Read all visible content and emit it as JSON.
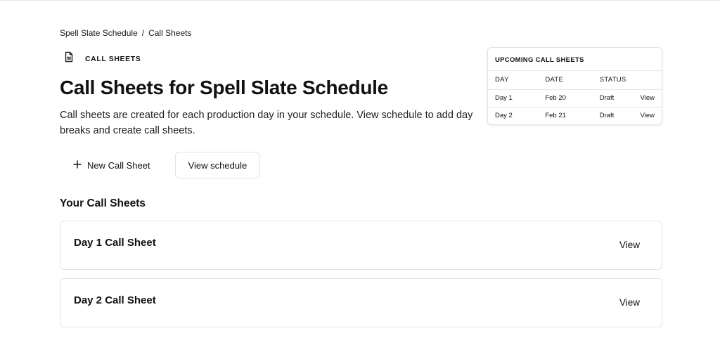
{
  "breadcrumb": {
    "parent": "Spell Slate Schedule",
    "separator": "/",
    "current": "Call Sheets"
  },
  "section": {
    "label": "CALL SHEETS",
    "icon": "document-icon"
  },
  "page": {
    "title": "Call Sheets for Spell Slate Schedule",
    "description": "Call sheets are created for each production day in your schedule. View schedule to add day breaks and create call sheets."
  },
  "actions": {
    "new_call_sheet": "New Call Sheet",
    "view_schedule": "View schedule"
  },
  "your_call_sheets": {
    "heading": "Your Call Sheets",
    "items": [
      {
        "name": "Day 1 Call Sheet",
        "action": "View"
      },
      {
        "name": "Day 2 Call Sheet",
        "action": "View"
      }
    ]
  },
  "upcoming": {
    "title": "UPCOMING CALL SHEETS",
    "columns": [
      "DAY",
      "DATE",
      "STATUS"
    ],
    "rows": [
      {
        "day": "Day 1",
        "date": "Feb 20",
        "status": "Draft",
        "action": "View"
      },
      {
        "day": "Day 2",
        "date": "Feb 21",
        "status": "Draft",
        "action": "View"
      }
    ]
  }
}
